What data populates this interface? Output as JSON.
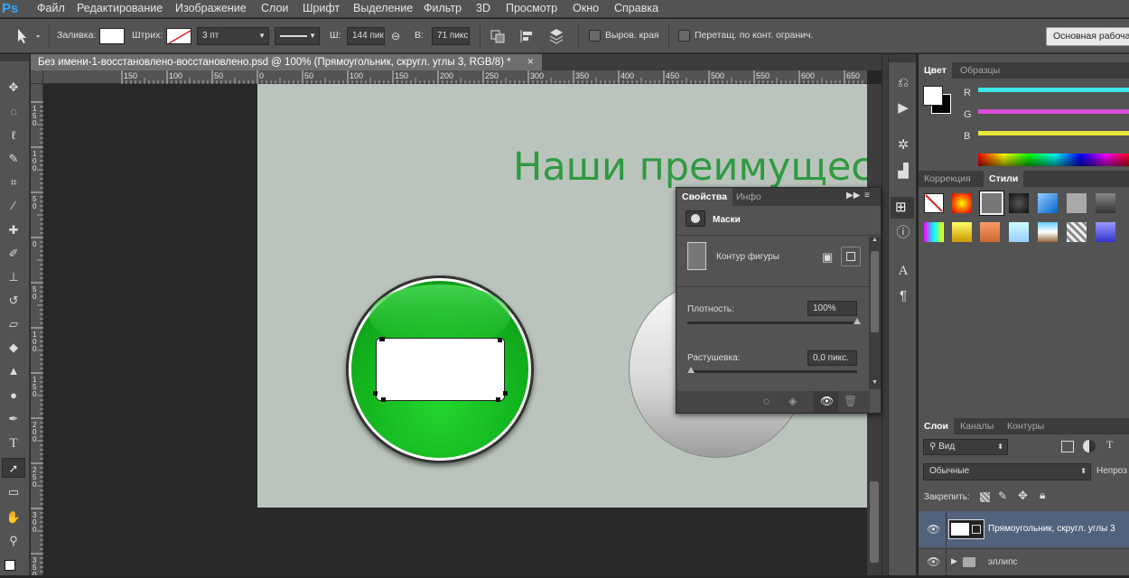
{
  "app": {
    "logo": "Ps"
  },
  "menu": [
    "Файл",
    "Редактирование",
    "Изображение",
    "Слои",
    "Шрифт",
    "Выделение",
    "Фильтр",
    "3D",
    "Просмотр",
    "Окно",
    "Справка"
  ],
  "options": {
    "fill_label": "Заливка:",
    "stroke_label": "Штрих:",
    "stroke_width": "3 пт",
    "w_label": "Ш:",
    "w_value": "144 пик",
    "h_label": "В:",
    "h_value": "71 пикс",
    "align_edges": "Выров. края",
    "drag_label": "Перетащ. по конт. огранич.",
    "workspace": "Основная рабочая"
  },
  "document": {
    "tab_title": "Без имени-1-восстановлено-восстановлено.psd @ 100% (Прямоугольник, скругл. углы 3, RGB/8) *",
    "close": "×",
    "heading_text": "Наши преимущес"
  },
  "ruler": {
    "h_ticks": [
      "150",
      "100",
      "50",
      "0",
      "50",
      "100",
      "150",
      "200",
      "250",
      "300",
      "350",
      "400",
      "450",
      "500",
      "550",
      "600",
      "650"
    ],
    "v_ticks": [
      "150",
      "100",
      "50",
      "0",
      "50",
      "100",
      "150",
      "200",
      "250",
      "300",
      "350"
    ]
  },
  "colors": {
    "canvas_bg": "#bac4bc",
    "heading": "#2f9a40",
    "button_green": "#12b21e",
    "panel_bg": "#535353"
  },
  "color_panel": {
    "tabs": [
      "Цвет",
      "Образцы"
    ],
    "channels": [
      {
        "label": "R",
        "color": "#3fe8e8"
      },
      {
        "label": "G",
        "color": "#d94cd9"
      },
      {
        "label": "B",
        "color": "#e8e83c"
      }
    ]
  },
  "adjust_panel": {
    "tabs": [
      "Коррекция",
      "Стили"
    ]
  },
  "properties": {
    "tabs": [
      "Свойства",
      "Инфо"
    ],
    "section": "Маски",
    "shape_path": "Контур фигуры",
    "density_label": "Плотность:",
    "density_value": "100%",
    "density_level": 1.0,
    "feather_label": "Растушевка:",
    "feather_value": "0,0 пикс.",
    "feather_level": 0.0
  },
  "layers": {
    "tabs": [
      "Слои",
      "Каналы",
      "Контуры"
    ],
    "filter": "Вид",
    "blend_mode": "Обычные",
    "opacity_label": "Непроз",
    "lock_label": "Закрепить:",
    "items": [
      {
        "name": "Прямоугольник, скругл. углы 3",
        "selected": true
      },
      {
        "name": "эллипс",
        "selected": false
      }
    ]
  }
}
